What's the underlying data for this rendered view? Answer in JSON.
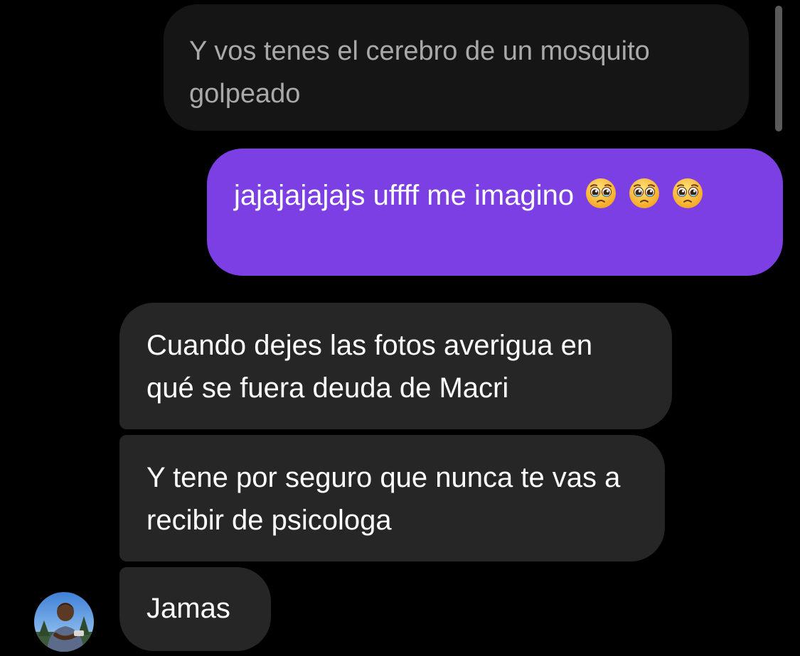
{
  "thread": {
    "messages": [
      {
        "sender": "other",
        "text": "Y vos tenes el cerebro de un mosquito golpeado"
      },
      {
        "sender": "me",
        "text": "jajajajajajs uffff me imagino",
        "emojis": [
          "pleading-face",
          "pleading-face",
          "pleading-face"
        ]
      },
      {
        "sender": "other",
        "text": "Cuando dejes las fotos averigua en qué se fuera deuda de Macri"
      },
      {
        "sender": "other",
        "text": "Y tene por seguro que nunca te vas a recibir de psicologa"
      },
      {
        "sender": "other",
        "text": "Jamas"
      }
    ]
  },
  "colors": {
    "background": "#000000",
    "incoming_bubble": "#262626",
    "faded_bubble": "#151515",
    "outgoing_bubble": "#7b3fe4",
    "text": "#ffffff"
  },
  "icons": {
    "avatar": "contact-avatar",
    "emoji": "pleading-face-emoji"
  }
}
